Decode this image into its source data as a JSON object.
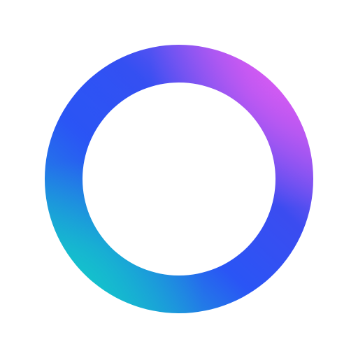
{
  "icon": {
    "name": "gradient-ring-logo",
    "colors": {
      "background": "#ffffff",
      "teal": "#12c9c9",
      "blue": "#2a55f5",
      "indigo": "#3b4cf0",
      "purple": "#9a56f2",
      "magenta": "#e35bf3"
    }
  }
}
